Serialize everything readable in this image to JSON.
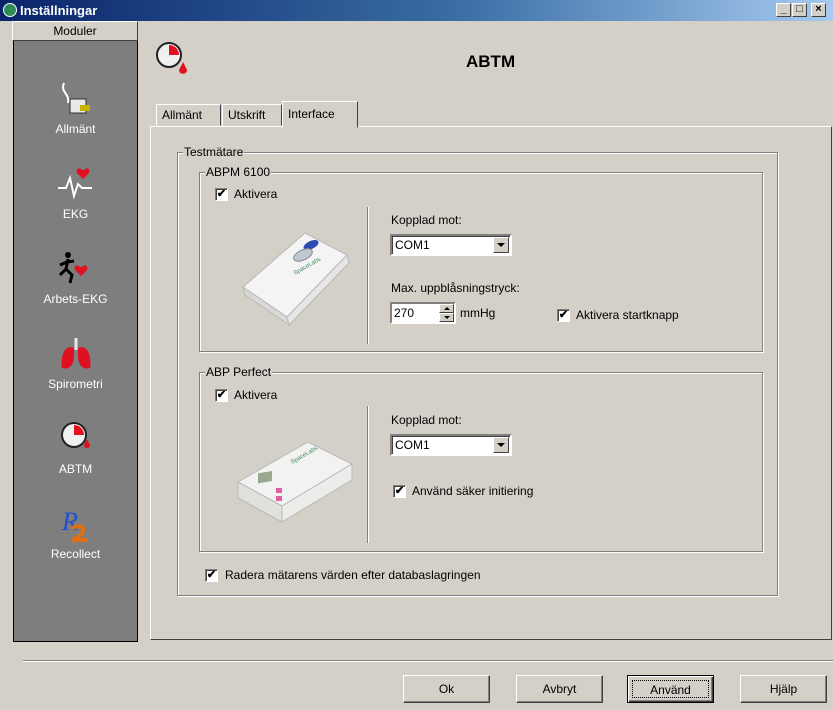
{
  "window": {
    "title": "Inställningar",
    "controls": {
      "minimize": "_",
      "maximize": "□",
      "close": "×"
    }
  },
  "sidebar": {
    "header": "Moduler",
    "items": [
      {
        "label": "Allmänt",
        "icon": "cable-plug-icon"
      },
      {
        "label": "EKG",
        "icon": "heart-ecg-icon"
      },
      {
        "label": "Arbets-EKG",
        "icon": "running-heart-icon"
      },
      {
        "label": "Spirometri",
        "icon": "lungs-icon"
      },
      {
        "label": "ABTM",
        "icon": "clock-blood-icon"
      },
      {
        "label": "Recollect",
        "icon": "r2-logo-icon"
      }
    ]
  },
  "header": {
    "title": "ABTM",
    "icon": "clock-blood-icon"
  },
  "tabs": [
    {
      "label": "Allmänt",
      "active": false
    },
    {
      "label": "Utskrift",
      "active": false
    },
    {
      "label": "Interface",
      "active": true
    }
  ],
  "testmatare": {
    "label": "Testmätare",
    "abpm": {
      "label": "ABPM 6100",
      "aktivera_label": "Aktivera",
      "aktivera_checked": true,
      "kopplad_label": "Kopplad mot:",
      "kopplad_value": "COM1",
      "max_label": "Max. uppblåsningstryck:",
      "max_value": "270",
      "unit": "mmHg",
      "startknapp_label": "Aktivera startknapp",
      "startknapp_checked": true
    },
    "abp_perfect": {
      "label": "ABP Perfect",
      "aktivera_label": "Aktivera",
      "aktivera_checked": true,
      "kopplad_label": "Kopplad mot:",
      "kopplad_value": "COM1",
      "saker_label": "Använd säker initiering",
      "saker_checked": true
    },
    "radera_label": "Radera mätarens värden efter databaslagringen",
    "radera_checked": true
  },
  "buttons": {
    "ok": "Ok",
    "avbryt": "Avbryt",
    "anvand": "Använd",
    "hjalp": "Hjälp"
  },
  "check_mark": "✔"
}
